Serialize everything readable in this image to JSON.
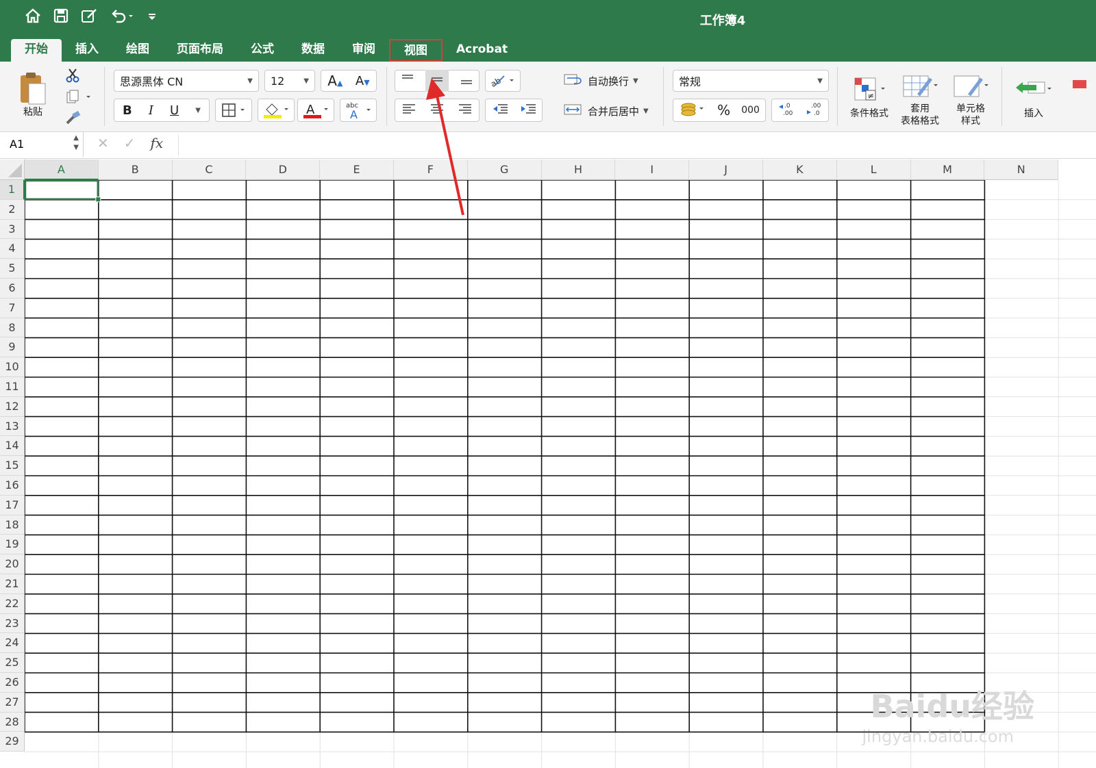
{
  "window": {
    "title": "工作簿4"
  },
  "qat": {
    "icons": [
      "home-icon",
      "save-icon",
      "edit-icon",
      "undo-icon",
      "customize-icon"
    ]
  },
  "tabs": [
    {
      "label": "开始",
      "active": true
    },
    {
      "label": "插入"
    },
    {
      "label": "绘图"
    },
    {
      "label": "页面布局"
    },
    {
      "label": "公式"
    },
    {
      "label": "数据"
    },
    {
      "label": "审阅"
    },
    {
      "label": "视图",
      "highlight": true
    },
    {
      "label": "Acrobat"
    }
  ],
  "ribbon": {
    "paste_label": "粘贴",
    "font_name": "思源黑体 CN",
    "font_size": "12",
    "bold": "B",
    "italic": "I",
    "underline": "U",
    "wrap_text": "自动换行",
    "merge_center": "合并后居中",
    "number_format": "常规",
    "percent": "%",
    "thousands": "000",
    "conditional_format": "条件格式",
    "table_format_line1": "套用",
    "table_format_line2": "表格格式",
    "cell_style_line1": "单元格",
    "cell_style_line2": "样式",
    "insert": "插入"
  },
  "formula_bar": {
    "name_box": "A1",
    "value": ""
  },
  "grid": {
    "columns": [
      "A",
      "B",
      "C",
      "D",
      "E",
      "F",
      "G",
      "H",
      "I",
      "J",
      "K",
      "L",
      "M",
      "N"
    ],
    "rows": [
      "1",
      "2",
      "3",
      "4",
      "5",
      "6",
      "7",
      "8",
      "9",
      "10",
      "11",
      "12",
      "13",
      "14",
      "15",
      "16",
      "17",
      "18",
      "19",
      "20",
      "21",
      "22",
      "23",
      "24",
      "25",
      "26",
      "27",
      "28",
      "29"
    ],
    "selected_cell": "A1",
    "bordered_range": "A1:M28"
  },
  "watermark": {
    "line1": "Baidu经验",
    "line2": "jingyan.baidu.com"
  },
  "colors": {
    "accent": "#2e7a4a",
    "highlight": "#e53935"
  }
}
